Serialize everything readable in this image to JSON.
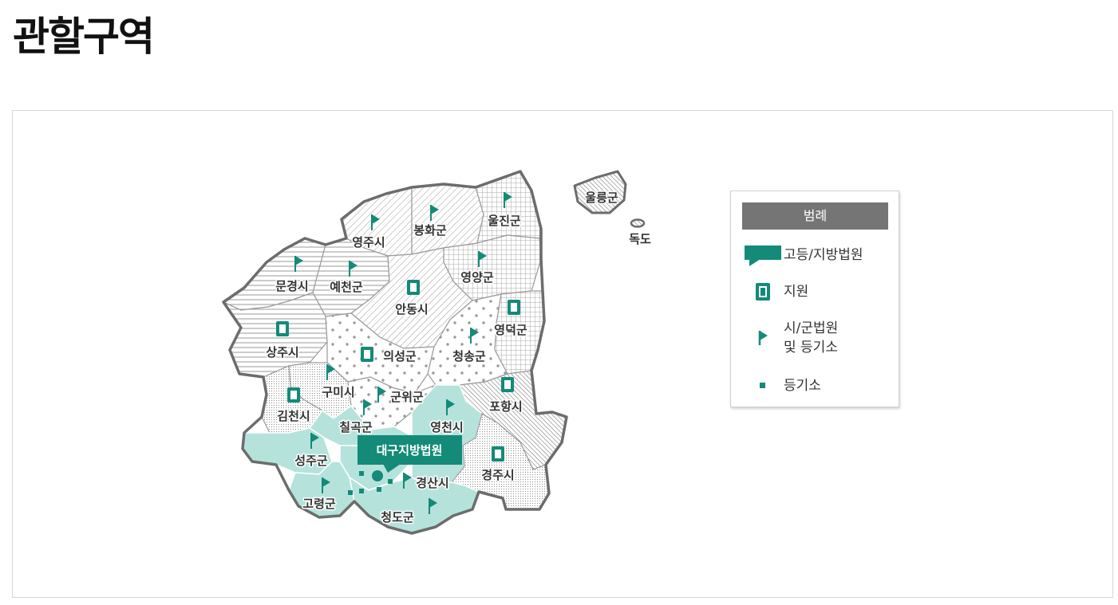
{
  "page": {
    "title": "관할구역"
  },
  "colors": {
    "accent": "#148a78",
    "court_area": "#b5e3dc",
    "legend_header": "#757575",
    "outline": "#6c6c6c"
  },
  "map": {
    "court_label": "대구지방법원",
    "regions": {
      "yeongju": "영주시",
      "bonghwa": "봉화군",
      "uljin": "울진군",
      "mungyeong": "문경시",
      "yecheon": "예천군",
      "yeongyang": "영양군",
      "andong": "안동시",
      "yeongdeok": "영덕군",
      "sangju": "상주시",
      "uiseong": "의성군",
      "cheongsong": "청송군",
      "gumi": "구미시",
      "gunwi": "군위군",
      "pohang": "포항시",
      "gimcheon": "김천시",
      "chilgok": "칠곡군",
      "yeongcheon": "영천시",
      "seongju": "성주군",
      "gyeongsan": "경산시",
      "gyeongju": "경주시",
      "goryeong": "고령군",
      "cheongdo": "청도군",
      "ulleung": "울릉군",
      "dokdo": "독도"
    }
  },
  "legend": {
    "title": "범례",
    "items": [
      {
        "symbol": "court-flag-icon",
        "label": "고등/지방법원"
      },
      {
        "symbol": "branch-building-icon",
        "label": "지원"
      },
      {
        "symbol": "flag-icon",
        "label": "시/군법원",
        "label2": "및 등기소"
      },
      {
        "symbol": "square-icon",
        "label": "등기소"
      }
    ]
  }
}
